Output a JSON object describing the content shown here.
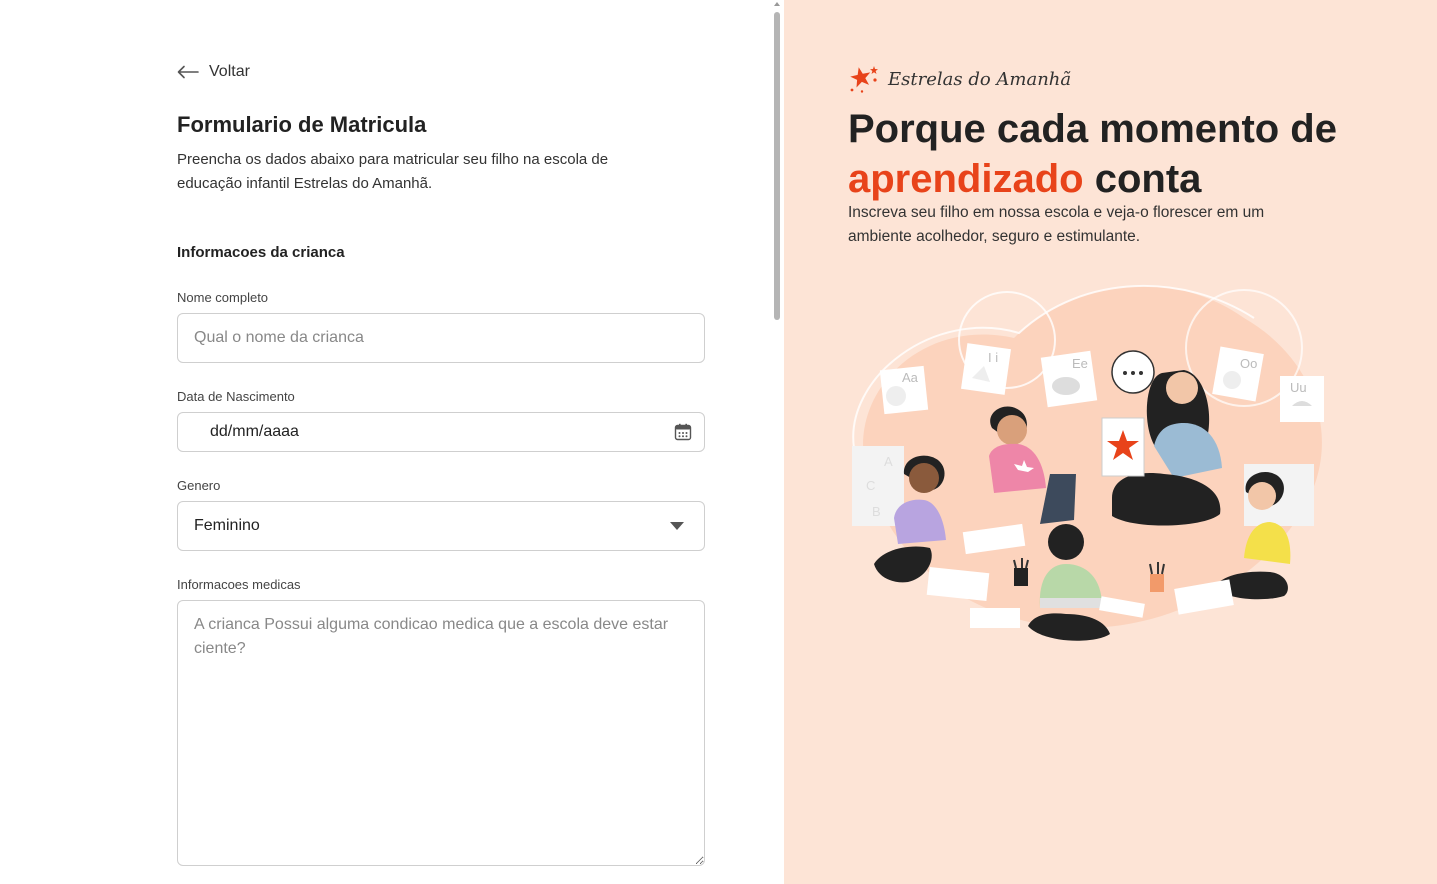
{
  "back_link": {
    "label": "Voltar"
  },
  "form": {
    "title": "Formulario de Matricula",
    "subtitle": "Preencha os dados abaixo para matricular seu filho na escola de educação infantil Estrelas do Amanhã.",
    "section_title": "Informacoes da crianca",
    "full_name": {
      "label": "Nome completo",
      "placeholder": "Qual o nome da crianca",
      "value": ""
    },
    "birth_date": {
      "label": "Data de Nascimento",
      "value": "dd/mm/aaaa"
    },
    "gender": {
      "label": "Genero",
      "selected": "Feminino"
    },
    "medical_info": {
      "label": "Informacoes medicas",
      "placeholder": "A crianca Possui alguma condicao medica que a escola deve estar ciente?",
      "value": ""
    }
  },
  "hero": {
    "brand_name": "Estrelas do Amanhã",
    "headline_part1": "Porque cada momento de ",
    "headline_accent": "aprendizado",
    "headline_part2": " conta",
    "lead": "Inscreva seu filho em nossa escola e veja-o florescer em um ambiente acolhedor, seguro e estimulante.",
    "illustration_cards": [
      "Aa",
      "Ii",
      "Ee",
      "Oo",
      "Uu"
    ],
    "accent_color": "#e8431a",
    "background_color": "#fde4d6"
  }
}
